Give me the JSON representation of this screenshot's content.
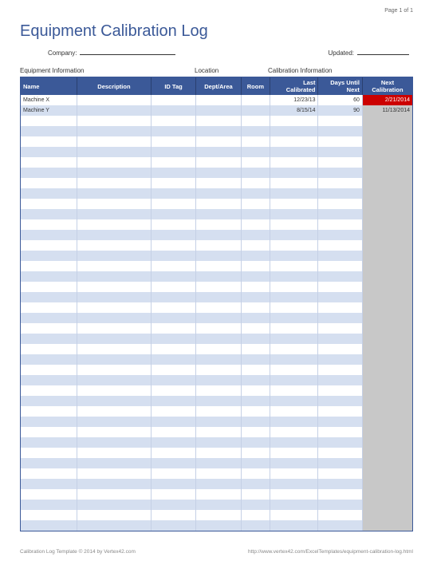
{
  "page_indicator": "Page 1 of 1",
  "title": "Equipment Calibration Log",
  "fields": {
    "company_label": "Company:",
    "company_value": "",
    "updated_label": "Updated:",
    "updated_value": ""
  },
  "section_headers": {
    "equipment": "Equipment Information",
    "location": "Location",
    "calibration": "Calibration Information"
  },
  "columns": {
    "name": "Name",
    "description": "Description",
    "idtag": "ID Tag",
    "dept": "Dept/Area",
    "room": "Room",
    "last": "Last Calibrated",
    "days": "Days Until Next",
    "next": "Next Calibration"
  },
  "rows": [
    {
      "name": "Machine X",
      "description": "",
      "idtag": "",
      "dept": "",
      "room": "",
      "last": "12/23/13",
      "days": "60",
      "next": "2/21/2014",
      "overdue": true
    },
    {
      "name": "Machine Y",
      "description": "",
      "idtag": "",
      "dept": "",
      "room": "",
      "last": "8/15/14",
      "days": "90",
      "next": "11/13/2014",
      "overdue": false
    }
  ],
  "empty_row_count": 40,
  "footer": {
    "left": "Calibration Log Template © 2014 by Vertex42.com",
    "right": "http://www.vertex42.com/ExcelTemplates/equipment-calibration-log.html"
  }
}
